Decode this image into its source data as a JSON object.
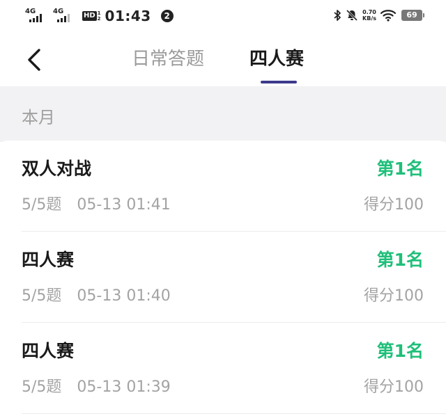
{
  "status_bar": {
    "network1": "4G",
    "network2": "4G",
    "hd_label": "HD",
    "hd_sub1": "1",
    "hd_sub2": "2",
    "time": "01:43",
    "notification_count": "2",
    "net_speed_value": "0.70",
    "net_speed_unit": "KB/s",
    "battery": "69"
  },
  "nav": {
    "tabs": [
      {
        "label": "日常答题",
        "active": false
      },
      {
        "label": "四人赛",
        "active": true
      }
    ],
    "accent_color": "#3c3a8c"
  },
  "section": {
    "label": "本月"
  },
  "records": [
    {
      "title": "双人对战",
      "rank": "第1名",
      "progress": "5/5题",
      "time": "05-13 01:41",
      "score": "得分100"
    },
    {
      "title": "四人赛",
      "rank": "第1名",
      "progress": "5/5题",
      "time": "05-13 01:40",
      "score": "得分100"
    },
    {
      "title": "四人赛",
      "rank": "第1名",
      "progress": "5/5题",
      "time": "05-13 01:39",
      "score": "得分100"
    }
  ],
  "colors": {
    "rank_green": "#1fbf7a",
    "muted_gray": "#a3a3a3",
    "section_bg": "#f2f2f4"
  }
}
